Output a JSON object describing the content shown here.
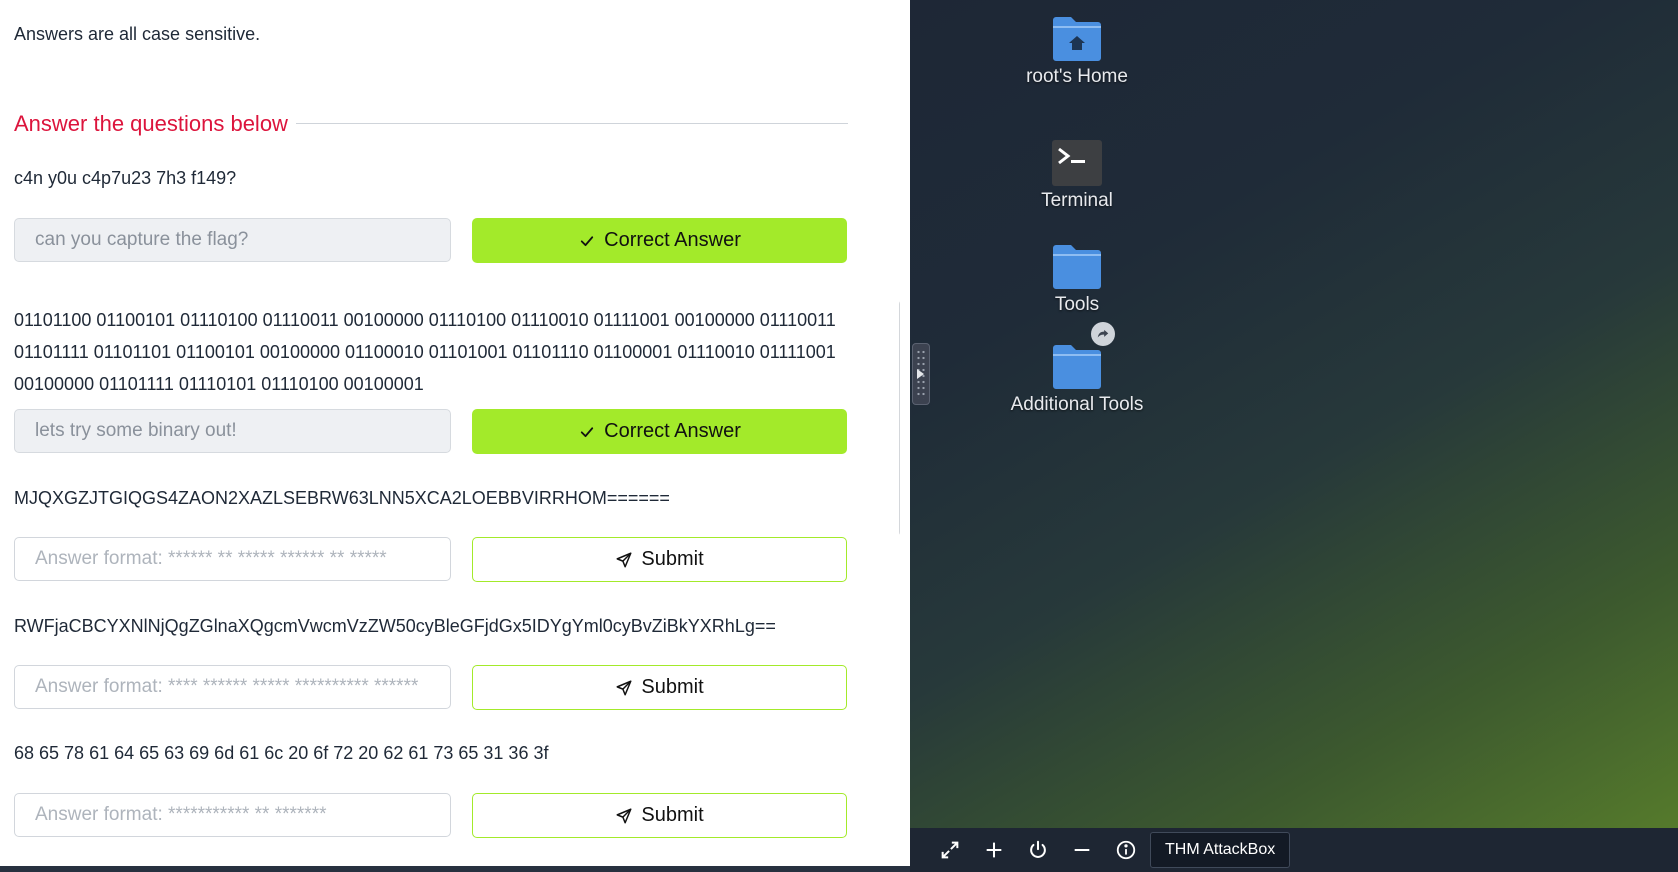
{
  "task": {
    "intro": "Answers are all case sensitive.",
    "section_heading": "Answer the questions below",
    "questions": [
      {
        "prompt": "c4n y0u c4p7u23 7h3 f149?",
        "answer_value": "can you capture the flag?",
        "button_label": "Correct Answer",
        "button_icon": "check-icon"
      },
      {
        "prompt": "01101100 01100101 01110100 01110011 00100000 01110100 01110010 01111001 00100000 01110011 01101111 01101101 01100101 00100000 01100010 01101001 01101110 01100001 01110010 01111001 00100000 01101111 01110101 01110100 00100001",
        "answer_value": "lets try some binary out!",
        "button_label": "Correct Answer",
        "button_icon": "check-icon"
      },
      {
        "prompt": "MJQXGZJTGIQGS4ZAON2XAZLSEBRW63LNN5XCA2LOEBBVIRRHOM======",
        "placeholder": "Answer format: ****** ** ***** ****** ** *****",
        "button_label": "Submit",
        "button_icon": "send-icon"
      },
      {
        "prompt": "RWFjaCBCYXNlNjQgZGlnaXQgcmVwcmVzZW50cyBleGFjdGx5IDYgYml0cyBvZiBkYXRhLg==",
        "placeholder": "Answer format: **** ****** ***** ********** ******",
        "button_label": "Submit",
        "button_icon": "send-icon"
      },
      {
        "prompt": "68 65 78 61 64 65 63 69 6d 61 6c 20 6f 72 20 62 61 73 65 31 36 3f",
        "placeholder": "Answer format: *********** ** *******",
        "button_label": "Submit",
        "button_icon": "send-icon"
      }
    ]
  },
  "desktop": {
    "icons": [
      {
        "label": "root's Home",
        "icon": "home-folder-icon"
      },
      {
        "label": "Terminal",
        "icon": "terminal-icon"
      },
      {
        "label": "Tools",
        "icon": "folder-icon"
      },
      {
        "label": "Additional Tools",
        "icon": "shared-folder-icon"
      }
    ]
  },
  "taskbar": {
    "buttons": [
      "fullscreen-icon",
      "plus-icon",
      "power-icon",
      "minus-icon",
      "info-icon"
    ],
    "attackbox_label": "THM AttackBox"
  },
  "colors": {
    "accent_green": "#a3ea2a",
    "heading_red": "#dc143c",
    "desktop_folder_blue": "#4a8fe0",
    "taskbar_bg": "#1e2633"
  }
}
